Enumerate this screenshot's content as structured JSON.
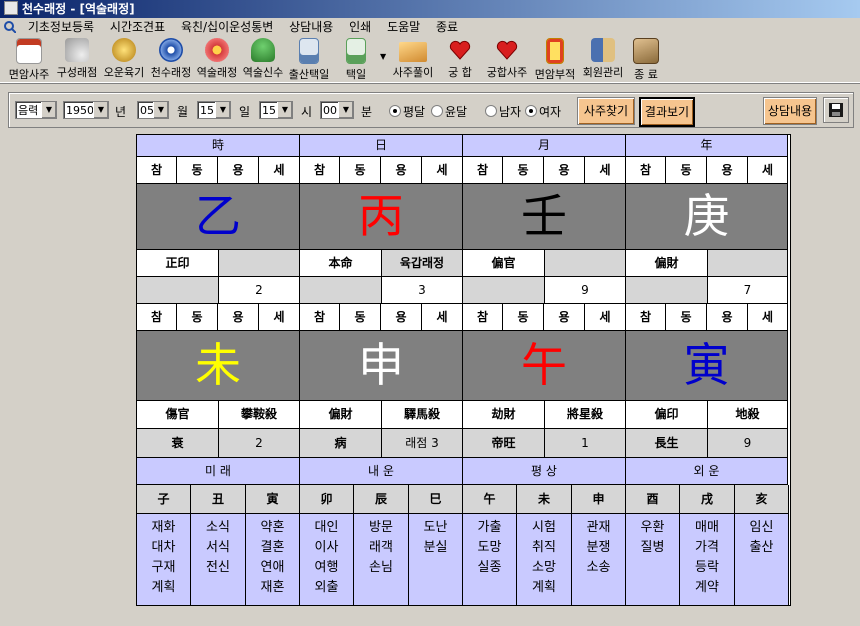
{
  "window": {
    "title": "천수래정 - [역술래정]"
  },
  "menu": [
    "기초정보등록",
    "시간조견표",
    "육친/십이운성통변",
    "상담내용",
    "인쇄",
    "도움말",
    "종료"
  ],
  "toolbar": [
    {
      "label": "면암사주",
      "icon": "calendar-icon",
      "color": "#c23b22"
    },
    {
      "label": "구성래점",
      "icon": "fan-icon",
      "color": "#b0b0b0"
    },
    {
      "label": "오운육기",
      "icon": "coin-icon",
      "color": "#d4a017"
    },
    {
      "label": "천수래정",
      "icon": "compass-icon",
      "color": "#1e4da8"
    },
    {
      "label": "역술래정",
      "icon": "wheel-icon",
      "color": "#d43c3c"
    },
    {
      "label": "역술신수",
      "icon": "tree-icon",
      "color": "#3a9a3a"
    },
    {
      "label": "출산택일",
      "icon": "device-icon",
      "color": "#5a7fb0"
    },
    {
      "label": "택일",
      "icon": "phone-icon",
      "color": "#5aa05a"
    },
    {
      "label": "사주풀이",
      "icon": "book-icon",
      "color": "#e0a050"
    },
    {
      "label": "궁 합",
      "icon": "heart-icon",
      "color": "#d81e1e"
    },
    {
      "label": "궁합사주",
      "icon": "heart-icon",
      "color": "#d81e1e"
    },
    {
      "label": "면암부적",
      "icon": "talisman-icon",
      "color": "#e0c020"
    },
    {
      "label": "회원관리",
      "icon": "members-icon",
      "color": "#4a70b0"
    },
    {
      "label": "종 료",
      "icon": "exit-icon",
      "color": "#8a6a3a"
    }
  ],
  "controls": {
    "calendar_type": "음력",
    "year": "1950",
    "year_unit": "년",
    "month": "05",
    "month_unit": "월",
    "day": "15",
    "day_unit": "일",
    "hour": "15",
    "hour_unit": "시",
    "minute": "00",
    "minute_unit": "분",
    "leap_normal": "평달",
    "leap_leap": "윤달",
    "gender_male": "남자",
    "gender_female": "여자",
    "find_button": "사주찾기",
    "result_button": "결과보기",
    "consult_button": "상담내용"
  },
  "board": {
    "pillars": [
      {
        "header": "時",
        "sub": [
          "참",
          "동",
          "용",
          "세"
        ],
        "stem": "乙",
        "stem_color": "#0000cc",
        "god_top": "正印",
        "god_top2": "",
        "num_a": "",
        "num_b": "2",
        "branch": "未",
        "branch_color": "#ffff00",
        "god_bot": "傷官",
        "sal": "攀鞍殺",
        "stage": "衰",
        "stage_num": "2"
      },
      {
        "header": "日",
        "sub": [
          "참",
          "동",
          "용",
          "세"
        ],
        "stem": "丙",
        "stem_color": "#ff0000",
        "god_top": "本命",
        "god_top2": "육갑래정",
        "num_a": "",
        "num_b": "3",
        "branch": "申",
        "branch_color": "#ffffff",
        "god_bot": "偏財",
        "sal": "驛馬殺",
        "stage": "病",
        "stage_num": "래점  3"
      },
      {
        "header": "月",
        "sub": [
          "참",
          "동",
          "용",
          "세"
        ],
        "stem": "壬",
        "stem_color": "#000000",
        "god_top": "偏官",
        "god_top2": "",
        "num_a": "",
        "num_b": "9",
        "branch": "午",
        "branch_color": "#ff0000",
        "god_bot": "劫財",
        "sal": "將星殺",
        "stage": "帝旺",
        "stage_num": "1"
      },
      {
        "header": "年",
        "sub": [
          "참",
          "동",
          "용",
          "세"
        ],
        "stem": "庚",
        "stem_color": "#ffffff",
        "god_top": "偏財",
        "god_top2": "",
        "num_a": "",
        "num_b": "7",
        "branch": "寅",
        "branch_color": "#0000cc",
        "god_bot": "偏印",
        "sal": "地殺",
        "stage": "長生",
        "stage_num": "9"
      }
    ],
    "fortune_headers": [
      "미  래",
      "내  운",
      "평  상",
      "외  운"
    ],
    "zodiac": [
      "子",
      "丑",
      "寅",
      "卯",
      "辰",
      "巳",
      "午",
      "未",
      "申",
      "酉",
      "戌",
      "亥"
    ],
    "fortune_lists": [
      [
        "재화",
        "대차",
        "구재",
        "계획"
      ],
      [
        "소식",
        "서식",
        "전신"
      ],
      [
        "약혼",
        "결혼",
        "연애",
        "재혼"
      ],
      [
        "대인",
        "이사",
        "여행",
        "외출"
      ],
      [
        "방문",
        "래객",
        "손님"
      ],
      [
        "도난",
        "분실"
      ],
      [
        "가출",
        "도망",
        "실종"
      ],
      [
        "시험",
        "취직",
        "소망",
        "계획"
      ],
      [
        "관재",
        "분쟁",
        "소송"
      ],
      [
        "우환",
        "질병"
      ],
      [
        "매매",
        "가격",
        "등락",
        "계약"
      ],
      [
        "임신",
        "출산"
      ]
    ]
  }
}
